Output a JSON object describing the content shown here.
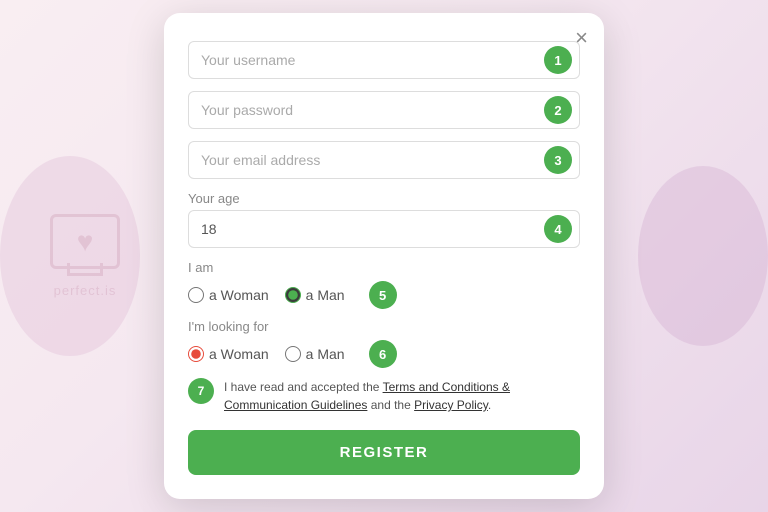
{
  "background": {
    "watermark_text": "perfect.is"
  },
  "modal": {
    "close_label": "×",
    "fields": [
      {
        "placeholder": "Your username",
        "step": "1",
        "name": "username-field"
      },
      {
        "placeholder": "Your password",
        "step": "2",
        "name": "password-field"
      },
      {
        "placeholder": "Your email address",
        "step": "3",
        "name": "email-field"
      }
    ],
    "age_label": "Your age",
    "age_value": "18",
    "age_step": "4",
    "i_am_label": "I am",
    "i_am_step": "5",
    "i_am_options": [
      {
        "value": "woman",
        "label": "a Woman",
        "checked": false
      },
      {
        "value": "man",
        "label": "a Man",
        "checked": true
      }
    ],
    "looking_for_label": "I'm looking for",
    "looking_for_step": "6",
    "looking_for_options": [
      {
        "value": "woman",
        "label": "a Woman",
        "checked": true
      },
      {
        "value": "man",
        "label": "a Man",
        "checked": false
      }
    ],
    "terms_step": "7",
    "terms_text_1": "I have read and accepted the ",
    "terms_link_1": "Terms and Conditions & Communication Guidelines",
    "terms_text_2": " and the ",
    "terms_link_2": "Privacy Policy",
    "terms_text_3": ".",
    "register_label": "REGISTER"
  }
}
